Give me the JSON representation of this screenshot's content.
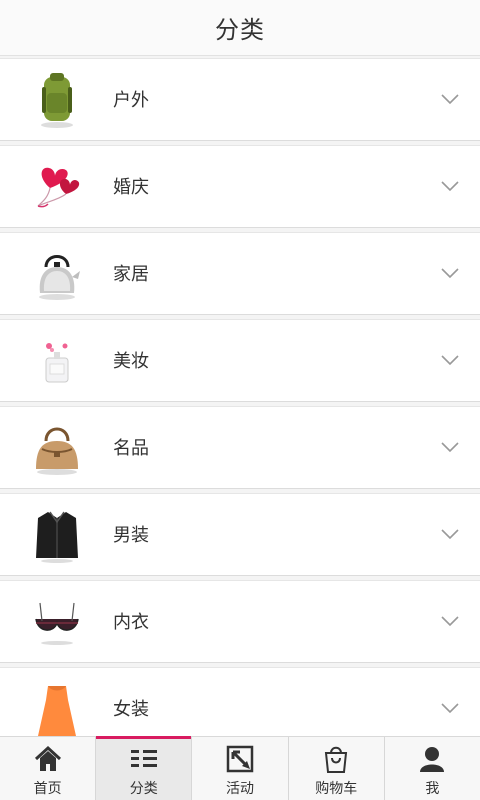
{
  "header": {
    "title": "分类"
  },
  "categories": [
    {
      "label": "户外",
      "icon": "backpack-icon"
    },
    {
      "label": "婚庆",
      "icon": "heart-balloons-icon"
    },
    {
      "label": "家居",
      "icon": "kettle-icon"
    },
    {
      "label": "美妆",
      "icon": "perfume-icon"
    },
    {
      "label": "名品",
      "icon": "handbag-icon"
    },
    {
      "label": "男装",
      "icon": "jacket-icon"
    },
    {
      "label": "内衣",
      "icon": "bra-icon"
    },
    {
      "label": "女装",
      "icon": "dress-icon"
    }
  ],
  "tabbar": {
    "active_color": "#d81b60",
    "tabs": [
      {
        "label": "首页",
        "icon": "home-icon"
      },
      {
        "label": "分类",
        "icon": "list-icon",
        "active": true
      },
      {
        "label": "活动",
        "icon": "activity-icon"
      },
      {
        "label": "购物车",
        "icon": "shopping-bag-icon"
      },
      {
        "label": "我",
        "icon": "user-icon"
      }
    ]
  }
}
